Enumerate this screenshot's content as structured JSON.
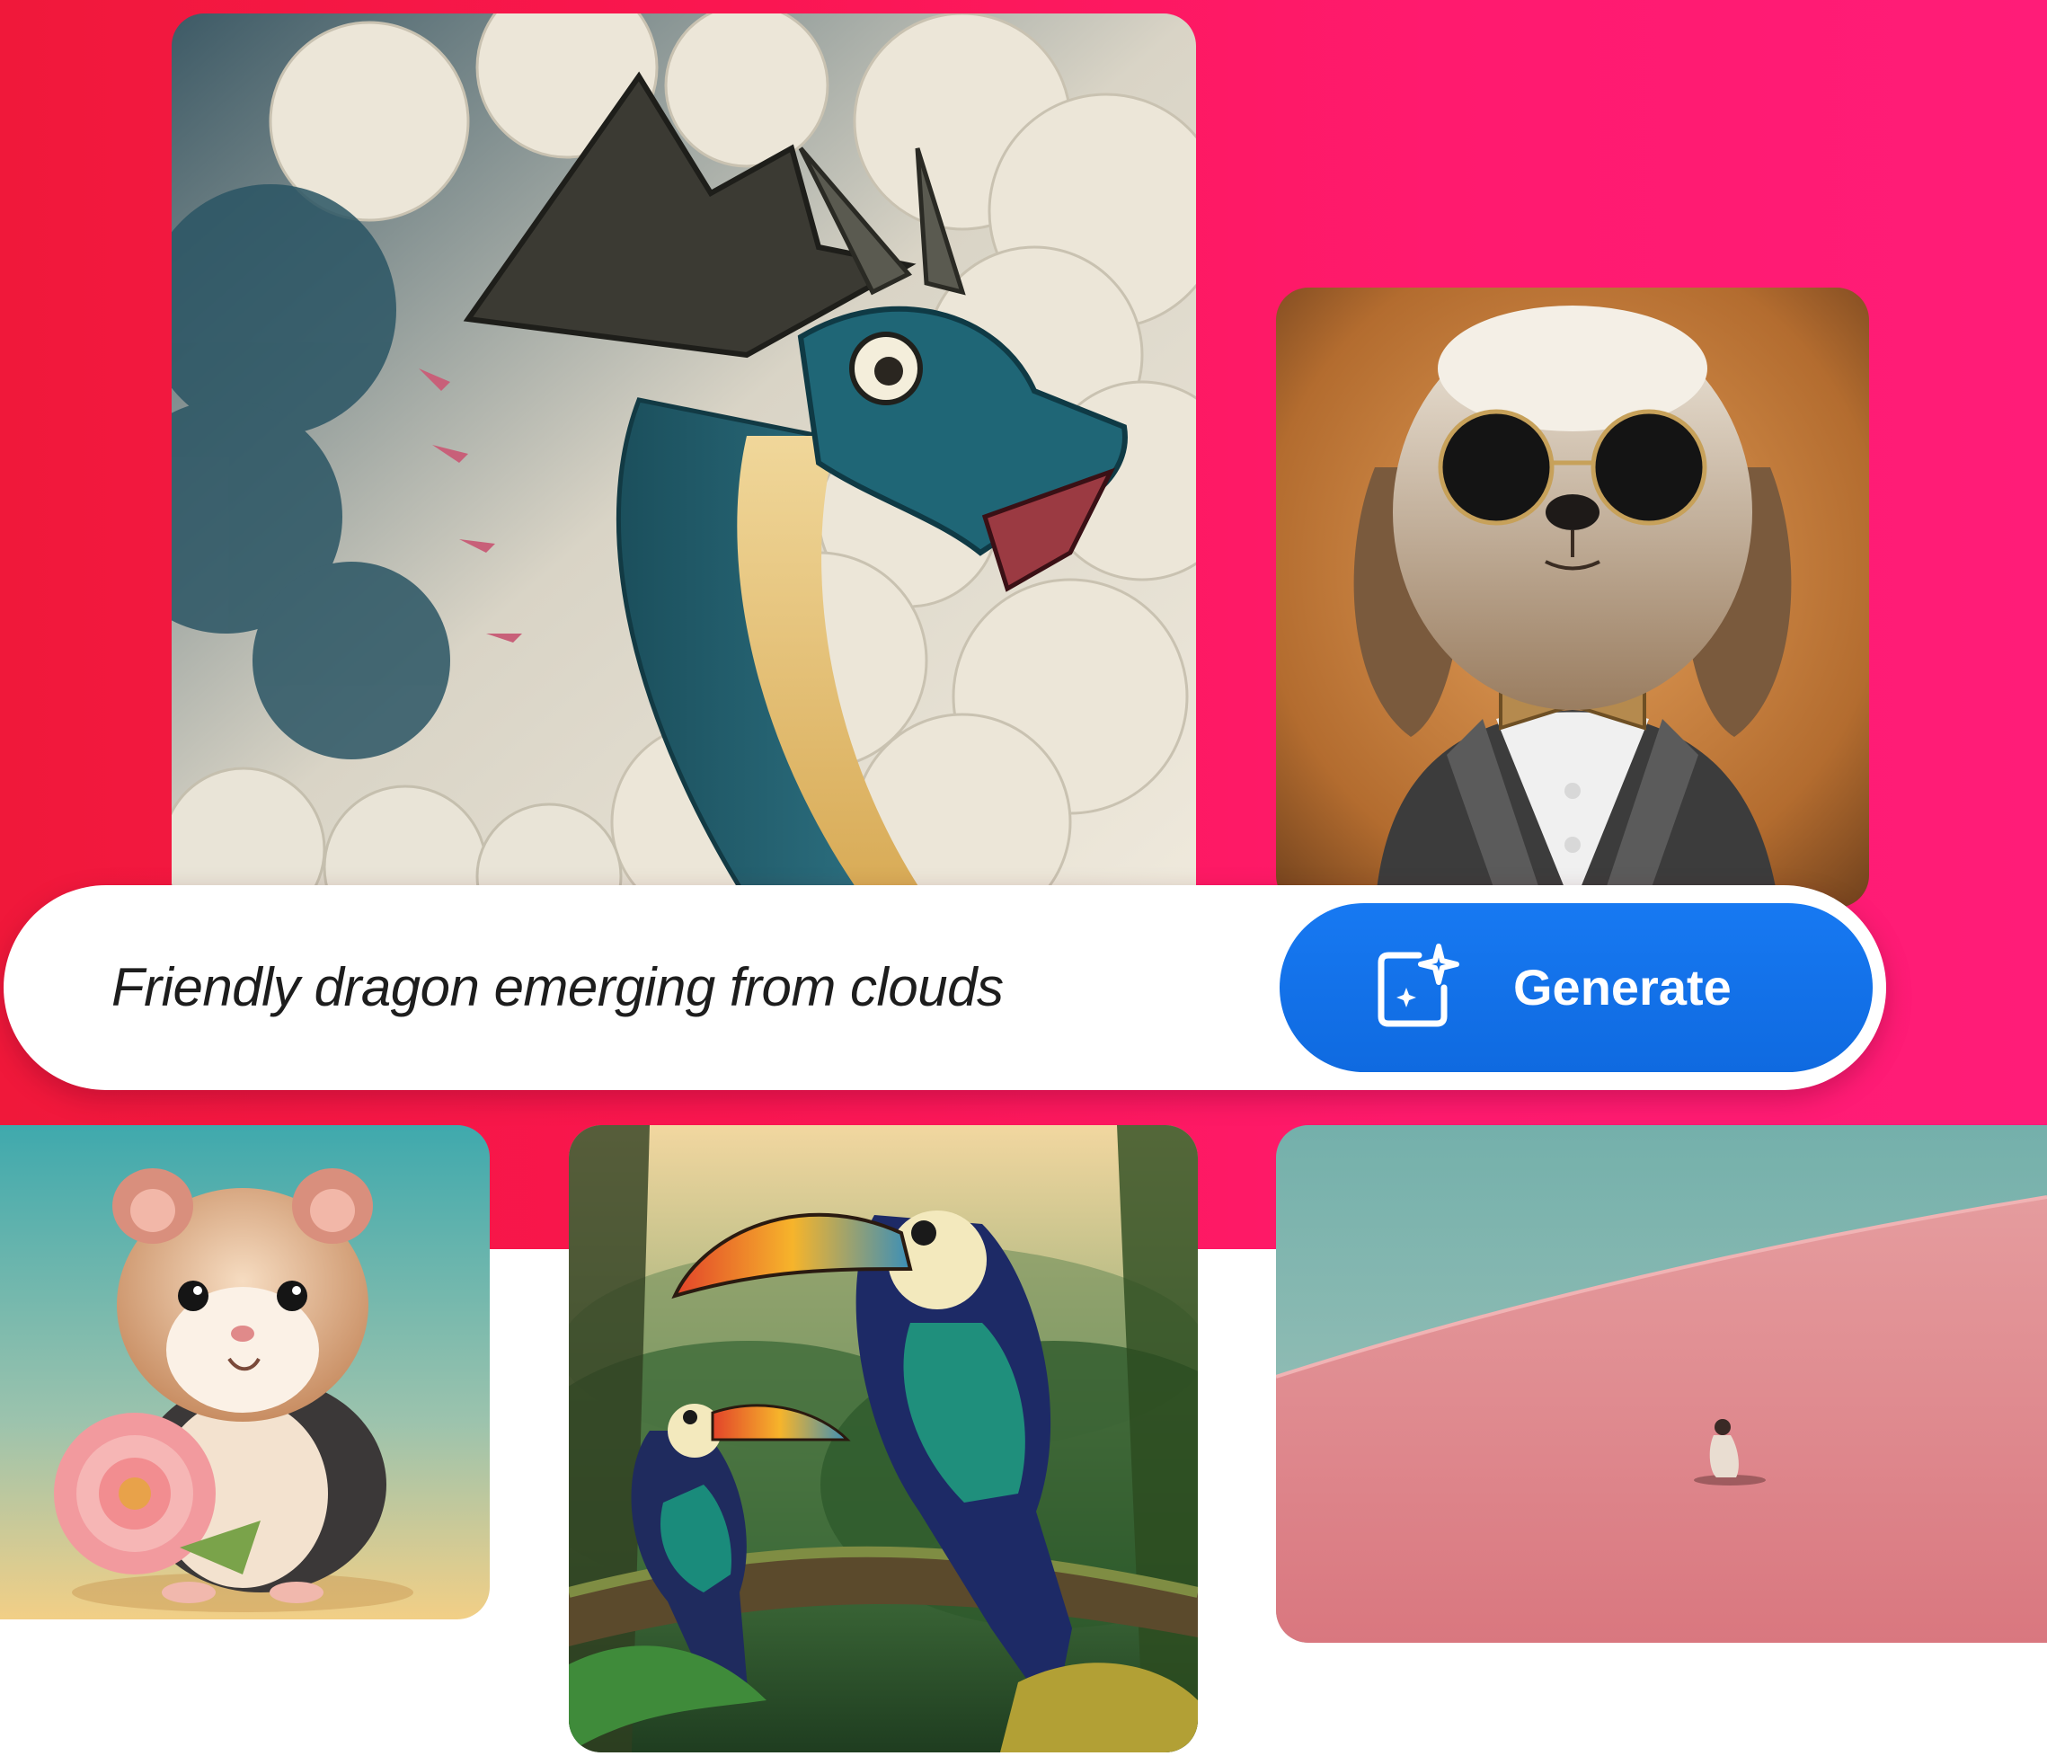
{
  "prompt": {
    "text": "Friendly dragon emerging from clouds"
  },
  "generate": {
    "label": "Generate",
    "icon": "sparkle-image-icon"
  },
  "colors": {
    "backdrop_left": "#f0183a",
    "backdrop_right": "#ff1c78",
    "button": "#1473e6",
    "prompt_text": "#1d1d1d"
  },
  "gallery": [
    {
      "subject": "dragon"
    },
    {
      "subject": "dog"
    },
    {
      "subject": "hamster"
    },
    {
      "subject": "toucans"
    },
    {
      "subject": "dune"
    }
  ]
}
